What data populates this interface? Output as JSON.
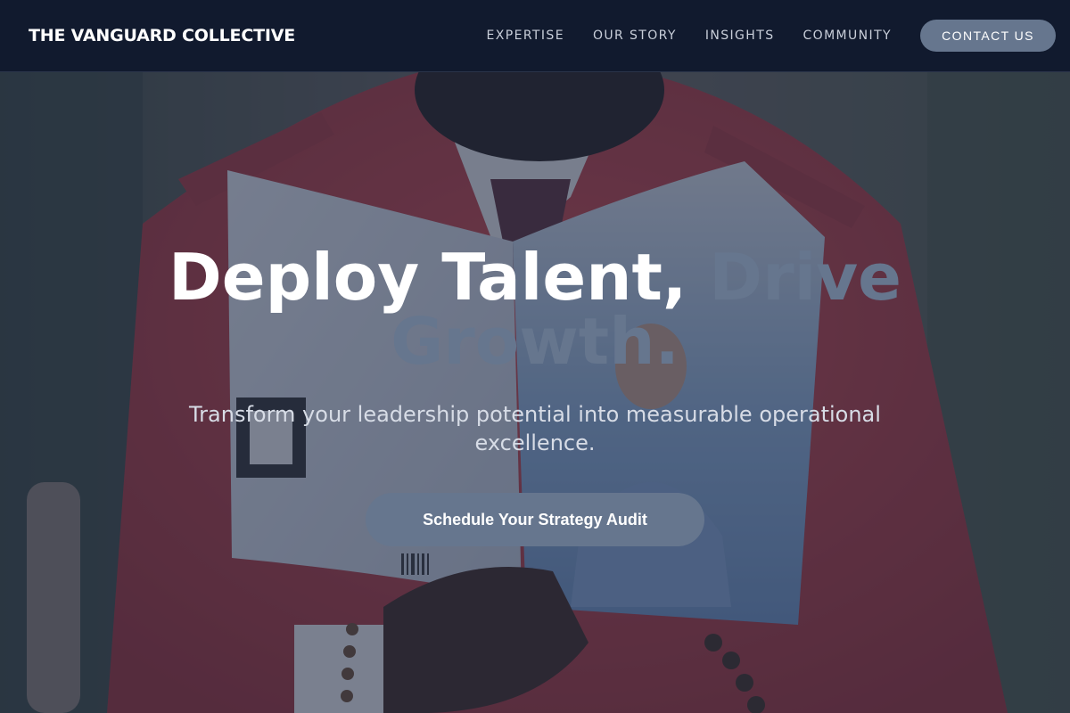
{
  "header": {
    "brand": "THE VANGUARD COLLECTIVE",
    "nav": [
      {
        "label": "EXPERTISE"
      },
      {
        "label": "OUR STORY"
      },
      {
        "label": "INSIGHTS"
      },
      {
        "label": "COMMUNITY"
      }
    ],
    "contact_label": "CONTACT US"
  },
  "hero": {
    "headline_main": "Deploy Talent, ",
    "headline_accent": "Drive Growth.",
    "subline": "Transform your leadership potential into measurable operational excellence.",
    "cta_label": "Schedule Your Strategy Audit",
    "background": "photo of a man in a red jacket reading an open book"
  },
  "colors": {
    "nav_bg": "#111a2e",
    "accent": "#66768e",
    "jacket": "#b23a3e",
    "text_light": "#ffffff"
  }
}
